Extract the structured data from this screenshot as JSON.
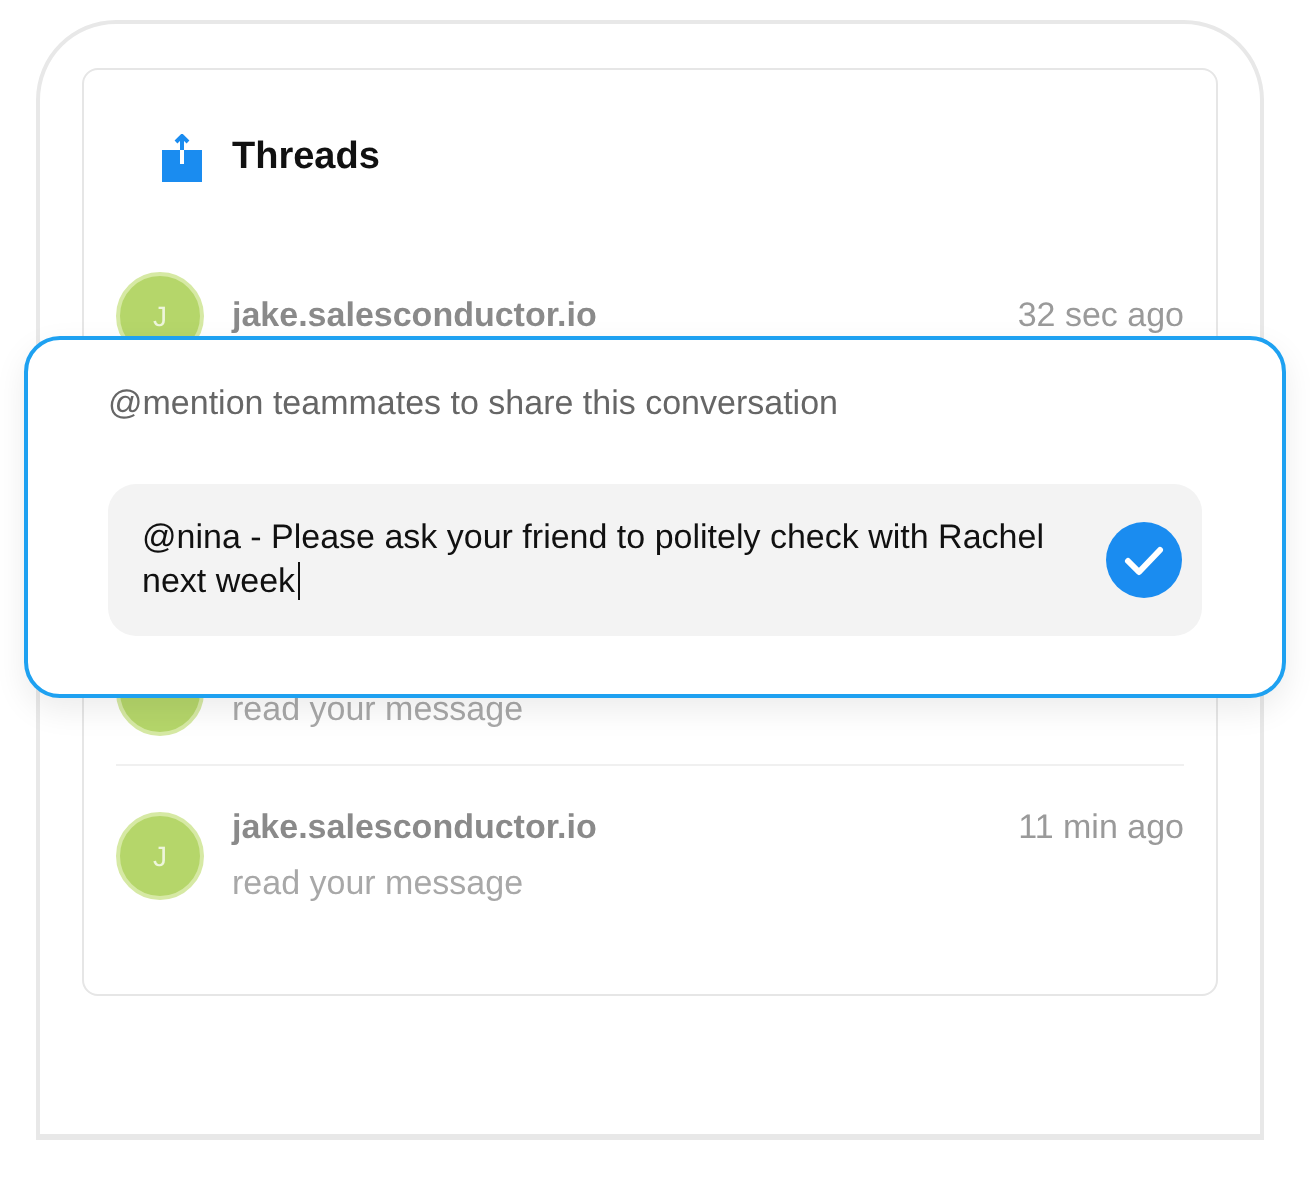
{
  "panel": {
    "title": "Threads"
  },
  "threads": [
    {
      "avatar": "J",
      "sender": "jake.salesconductor.io",
      "time": "32 sec ago"
    },
    {
      "message": "read your message"
    },
    {
      "avatar": "J",
      "sender": "jake.salesconductor.io",
      "time": "11 min ago",
      "message": "read your message"
    }
  ],
  "share_popup": {
    "label": "@mention teammates to share this conversation",
    "value": "@nina - Please ask your friend to politely check with Rachel next week",
    "focused": true
  }
}
